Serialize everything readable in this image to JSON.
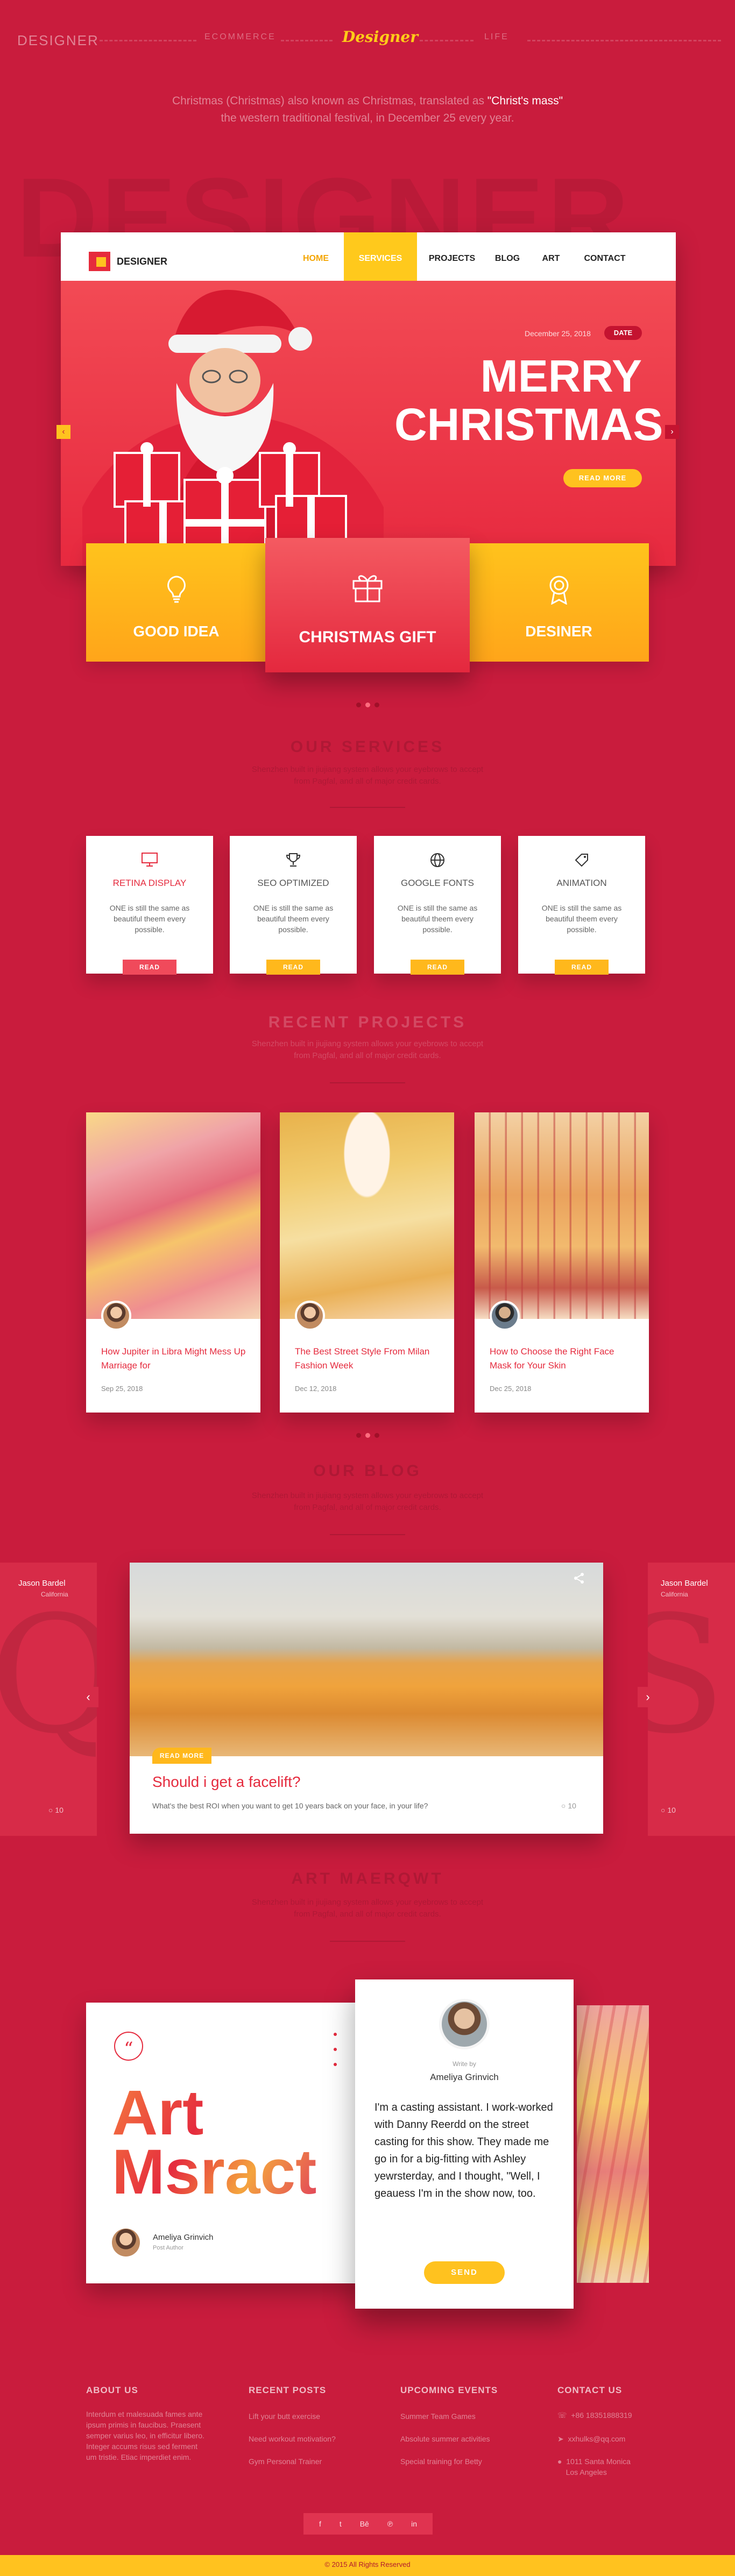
{
  "header": {
    "left_title": "DESIGNER",
    "mid_text": "ECOMMERCE",
    "logo": "Designer",
    "right_text": "LIFE"
  },
  "intro": {
    "line1_pre": "Christmas (Christmas) also known as Christmas, translated as ",
    "line1_hl": "\"Christ's mass\"",
    "line2": "the western traditional festival, in December 25 every year."
  },
  "background_word": "DESIGNER",
  "hero": {
    "brand": "DESIGNER",
    "nav": [
      "HOME",
      "SERVICES",
      "PROJECTS",
      "BLOG",
      "ART",
      "CONTACT"
    ],
    "active_nav": "SERVICES",
    "date": "December 25, 2018",
    "date_badge": "DATE",
    "headline_1": "MERRY",
    "headline_2": "CHRISTMAS",
    "read_more": "READ MORE"
  },
  "features": [
    {
      "label": "GOOD IDEA",
      "icon": "lightbulb-icon"
    },
    {
      "label": "CHRISTMAS GIFT",
      "icon": "gift-icon"
    },
    {
      "label": "DESINER",
      "icon": "award-icon"
    }
  ],
  "services": {
    "title": "OUR SERVICES",
    "subtitle_1": "Shenzhen built in jiujiang system allows your eyebrows to accept",
    "subtitle_2": "from Pagfal, and all of major credit cards.",
    "items": [
      {
        "name": "RETINA DISPLAY",
        "icon": "monitor-icon",
        "desc": "ONE is still the same  as beautiful theem every possible.",
        "btn": "READ"
      },
      {
        "name": "SEO OPTIMIZED",
        "icon": "trophy-icon",
        "desc": "ONE is still the same  as beautiful theem every possible.",
        "btn": "READ"
      },
      {
        "name": "GOOGLE FONTS",
        "icon": "globe-icon",
        "desc": "ONE is still the same  as beautiful theem every possible.",
        "btn": "READ"
      },
      {
        "name": "ANIMATION",
        "icon": "tag-icon",
        "desc": "ONE is still the same  as beautiful theem every possible.",
        "btn": "READ"
      }
    ]
  },
  "projects": {
    "title": "RECENT PROJECTS",
    "subtitle_1": "Shenzhen built in jiujiang system allows your eyebrows to accept",
    "subtitle_2": "from Pagfal, and all of major credit cards.",
    "items": [
      {
        "title": "How Jupiter in Libra Might Mess Up Marriage for",
        "date": "Sep 25, 2018"
      },
      {
        "title": "The Best Street Style From Milan Fashion Week",
        "date": "Dec 12, 2018"
      },
      {
        "title": "How to Choose the Right Face Mask for Your Skin",
        "date": "Dec 25, 2018"
      }
    ]
  },
  "blog": {
    "title": "OUR BLOG",
    "subtitle_1": "Shenzhen built in jiujiang system allows your eyebrows to accept",
    "subtitle_2": "from Pagfal, and all of major credit cards.",
    "side_name": "Jason Bardel",
    "side_place": "California",
    "side_count": "10",
    "read_more": "READ MORE",
    "post_title": "Should i get a facelift?",
    "post_excerpt": "What's the best ROI when you want to get 10 years back on your face, in your life?",
    "comments": "10"
  },
  "art": {
    "title": "ART MAERQWT",
    "subtitle_1": "Shenzhen built in jiujiang system allows your eyebrows to accept",
    "subtitle_2": "from Pagfal, and all of major credit cards.",
    "big_1": "Art",
    "big_2": "Msract",
    "author": "Ameliya Grinvich",
    "author_role": "Post Author",
    "write_by": "Write by",
    "quote_author": "Ameliya Grinvich",
    "quote": "I'm a casting assistant. I  work-worked with Danny Reerdd on the street casting for this show. They made me go in for a big-fitting with Ashley yewrsterday, and I thought, \"Well, I geauess I'm in the show now, too.",
    "send": "SEND"
  },
  "footer": {
    "about_h": "ABOUT US",
    "about_t": "Interdum et malesuada fames ante ipsum primis in faucibus. Praesent semper varius leo, in efficitur libero. Integer accums risus sed ferment um tristie. Etiac imperdiet enim.",
    "posts_h": "RECENT POSTS",
    "posts": [
      "Lift your butt  exercise",
      "Need workout motivation?",
      "Gym Personal Trainer"
    ],
    "events_h": "UPCOMING EVENTS",
    "events": [
      "Summer Team Games",
      "Absolute summer activities",
      "Special training for Betty"
    ],
    "contact_h": "CONTACT US",
    "phone": "+86 18351888319",
    "email": "xxhulks@qq.com",
    "addr_1": "1011 Santa Monica",
    "addr_2": "Los Angeles",
    "social": [
      "f",
      "t",
      "Bē",
      "℗",
      "in"
    ],
    "copyright": "© 2015 All Rights Reserved"
  }
}
